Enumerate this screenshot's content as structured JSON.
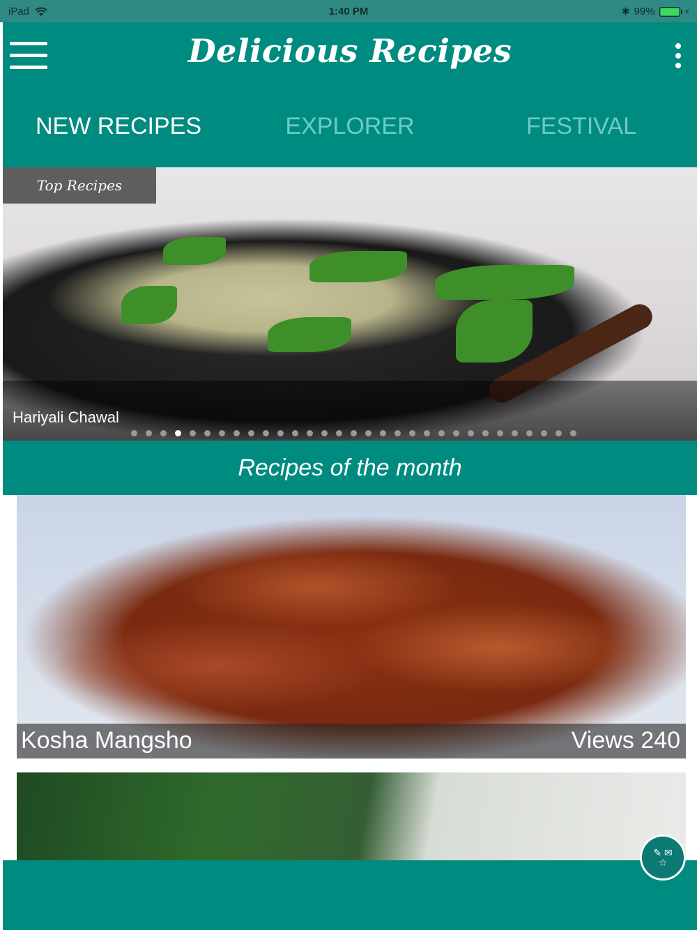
{
  "status_bar": {
    "device": "iPad",
    "time": "1:40 PM",
    "battery": "99%"
  },
  "header": {
    "title": "Delicious Recipes"
  },
  "tabs": [
    {
      "label": "NEW RECIPES",
      "active": true
    },
    {
      "label": "EXPLORER",
      "active": false
    },
    {
      "label": "FESTIVAL",
      "active": false
    }
  ],
  "hero": {
    "badge": "Top Recipes",
    "title": "Hariyali Chawal",
    "slide_count": 31,
    "active_slide": 4
  },
  "section": {
    "title": "Recipes of the month"
  },
  "recipes": [
    {
      "name": "Kosha Mangsho",
      "views": "Views 240"
    }
  ],
  "fab": {
    "icons": [
      "edit-icon",
      "mail-icon",
      "star-icon"
    ]
  },
  "colors": {
    "primary": "#008b80",
    "tab_inactive": "#6fcbc2",
    "status_bar": "#2e8a82"
  }
}
